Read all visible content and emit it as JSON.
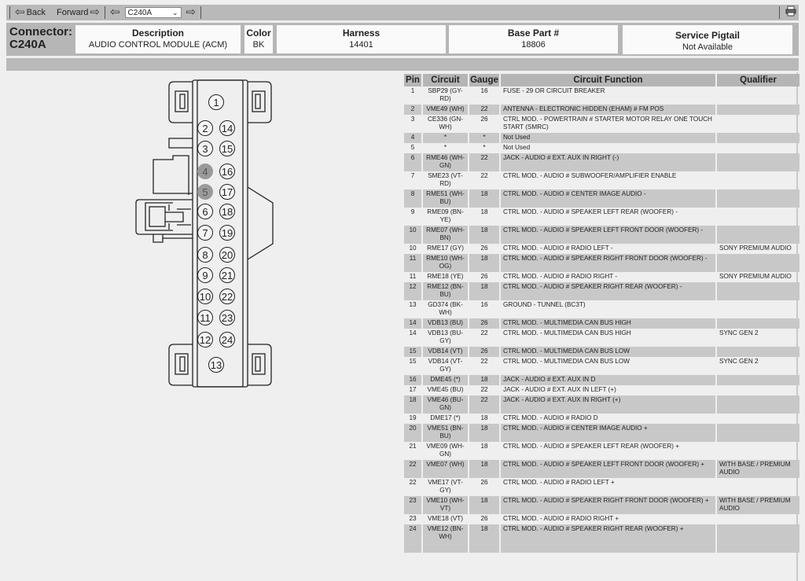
{
  "toolbar": {
    "back_label": "Back",
    "forward_label": "Forward",
    "connector_select": "C240A",
    "print_icon": "printer-icon"
  },
  "connector": {
    "label": "Connector:",
    "id": "C240A",
    "description_header": "Description",
    "description": "AUDIO CONTROL MODULE (ACM)",
    "color_header": "Color",
    "color": "BK",
    "harness_header": "Harness",
    "harness": "14401",
    "base_part_header": "Base Part #",
    "base_part": "18806",
    "pigtail_header": "Service Pigtail",
    "pigtail": "Not Available"
  },
  "table": {
    "headers": [
      "Pin",
      "Circuit",
      "Gauge",
      "Circuit Function",
      "Qualifier"
    ],
    "rows": [
      {
        "pin": "1",
        "circuit": "SBP29 (GY-RD)",
        "gauge": "16",
        "function": "FUSE - 29 OR CIRCUIT BREAKER",
        "qualifier": ""
      },
      {
        "pin": "2",
        "circuit": "VME49 (WH)",
        "gauge": "22",
        "function": "ANTENNA - ELECTRONIC HIDDEN (EHAM) # FM POS",
        "qualifier": ""
      },
      {
        "pin": "3",
        "circuit": "CE336 (GN-WH)",
        "gauge": "26",
        "function": "CTRL MOD. - POWERTRAIN # STARTER MOTOR RELAY ONE TOUCH START (SMRC)",
        "qualifier": ""
      },
      {
        "pin": "4",
        "circuit": "*",
        "gauge": "*",
        "function": "Not Used",
        "qualifier": ""
      },
      {
        "pin": "5",
        "circuit": "*",
        "gauge": "*",
        "function": "Not Used",
        "qualifier": ""
      },
      {
        "pin": "6",
        "circuit": "RME46 (WH-GN)",
        "gauge": "22",
        "function": "JACK - AUDIO # EXT. AUX IN RIGHT (-)",
        "qualifier": ""
      },
      {
        "pin": "7",
        "circuit": "SME23 (VT-RD)",
        "gauge": "22",
        "function": "CTRL MOD. - AUDIO # SUBWOOFER/AMPLIFIER ENABLE",
        "qualifier": ""
      },
      {
        "pin": "8",
        "circuit": "RME51 (WH-BU)",
        "gauge": "18",
        "function": "CTRL MOD. - AUDIO # CENTER IMAGE AUDIO -",
        "qualifier": ""
      },
      {
        "pin": "9",
        "circuit": "RME09 (BN-YE)",
        "gauge": "18",
        "function": "CTRL MOD. - AUDIO # SPEAKER LEFT REAR (WOOFER) -",
        "qualifier": ""
      },
      {
        "pin": "10",
        "circuit": "RME07 (WH-BN)",
        "gauge": "18",
        "function": "CTRL MOD. - AUDIO # SPEAKER LEFT FRONT DOOR (WOOFER) -",
        "qualifier": ""
      },
      {
        "pin": "10",
        "circuit": "RME17 (GY)",
        "gauge": "26",
        "function": "CTRL MOD. - AUDIO # RADIO LEFT -",
        "qualifier": "SONY PREMIUM AUDIO"
      },
      {
        "pin": "11",
        "circuit": "RME10 (WH-OG)",
        "gauge": "18",
        "function": "CTRL MOD. - AUDIO # SPEAKER RIGHT FRONT DOOR (WOOFER) -",
        "qualifier": ""
      },
      {
        "pin": "11",
        "circuit": "RME18 (YE)",
        "gauge": "26",
        "function": "CTRL MOD. - AUDIO # RADIO RIGHT -",
        "qualifier": "SONY PREMIUM AUDIO"
      },
      {
        "pin": "12",
        "circuit": "RME12 (BN-BU)",
        "gauge": "18",
        "function": "CTRL MOD. - AUDIO # SPEAKER RIGHT REAR (WOOFER) -",
        "qualifier": ""
      },
      {
        "pin": "13",
        "circuit": "GD374 (BK-WH)",
        "gauge": "16",
        "function": "GROUND - TUNNEL (BC3T)",
        "qualifier": ""
      },
      {
        "pin": "14",
        "circuit": "VDB13 (BU)",
        "gauge": "26",
        "function": "CTRL MOD. - MULTIMEDIA CAN BUS HIGH",
        "qualifier": ""
      },
      {
        "pin": "14",
        "circuit": "VDB13 (BU-GY)",
        "gauge": "22",
        "function": "CTRL MOD. - MULTIMEDIA CAN BUS HIGH",
        "qualifier": "SYNC GEN 2"
      },
      {
        "pin": "15",
        "circuit": "VDB14 (VT)",
        "gauge": "26",
        "function": "CTRL MOD. - MULTIMEDIA CAN BUS LOW",
        "qualifier": ""
      },
      {
        "pin": "15",
        "circuit": "VDB14 (VT-GY)",
        "gauge": "22",
        "function": "CTRL MOD. - MULTIMEDIA CAN BUS LOW",
        "qualifier": "SYNC GEN 2"
      },
      {
        "pin": "16",
        "circuit": "DME45 (*)",
        "gauge": "18",
        "function": "JACK - AUDIO # EXT. AUX IN D",
        "qualifier": ""
      },
      {
        "pin": "17",
        "circuit": "VME45 (BU)",
        "gauge": "22",
        "function": "JACK - AUDIO # EXT. AUX IN LEFT (+)",
        "qualifier": ""
      },
      {
        "pin": "18",
        "circuit": "VME46 (BU-GN)",
        "gauge": "22",
        "function": "JACK - AUDIO # EXT. AUX IN RIGHT (+)",
        "qualifier": ""
      },
      {
        "pin": "19",
        "circuit": "DME17 (*)",
        "gauge": "18",
        "function": "CTRL MOD. - AUDIO # RADIO D",
        "qualifier": ""
      },
      {
        "pin": "20",
        "circuit": "VME51 (BN-BU)",
        "gauge": "18",
        "function": "CTRL MOD. - AUDIO # CENTER IMAGE AUDIO +",
        "qualifier": ""
      },
      {
        "pin": "21",
        "circuit": "VME09 (WH-GN)",
        "gauge": "18",
        "function": "CTRL MOD. - AUDIO # SPEAKER LEFT REAR (WOOFER) +",
        "qualifier": ""
      },
      {
        "pin": "22",
        "circuit": "VME07 (WH)",
        "gauge": "18",
        "function": "CTRL MOD. - AUDIO # SPEAKER LEFT FRONT DOOR (WOOFER) +",
        "qualifier": "WITH BASE / PREMIUM AUDIO"
      },
      {
        "pin": "22",
        "circuit": "VME17 (VT-GY)",
        "gauge": "26",
        "function": "CTRL MOD. - AUDIO # RADIO LEFT +",
        "qualifier": ""
      },
      {
        "pin": "23",
        "circuit": "VME10 (WH-VT)",
        "gauge": "18",
        "function": "CTRL MOD. - AUDIO # SPEAKER RIGHT FRONT DOOR (WOOFER) +",
        "qualifier": "WITH BASE / PREMIUM AUDIO"
      },
      {
        "pin": "23",
        "circuit": "VME18 (VT)",
        "gauge": "26",
        "function": "CTRL MOD. - AUDIO # RADIO RIGHT +",
        "qualifier": ""
      },
      {
        "pin": "24",
        "circuit": "VME12 (BN-WH)",
        "gauge": "18",
        "function": "CTRL MOD. - AUDIO # SPEAKER RIGHT REAR (WOOFER) +",
        "qualifier": ""
      },
      {
        "pin": "",
        "circuit": "",
        "gauge": "",
        "function": "",
        "qualifier": ""
      }
    ]
  },
  "diagram": {
    "pins_left": [
      "1",
      "2",
      "3",
      "4",
      "5",
      "6",
      "7",
      "8",
      "9",
      "10",
      "11",
      "12",
      "13"
    ],
    "pins_right": [
      "14",
      "15",
      "16",
      "17",
      "18",
      "19",
      "20",
      "21",
      "22",
      "23",
      "24"
    ],
    "unused_pins": [
      "4",
      "5"
    ]
  }
}
